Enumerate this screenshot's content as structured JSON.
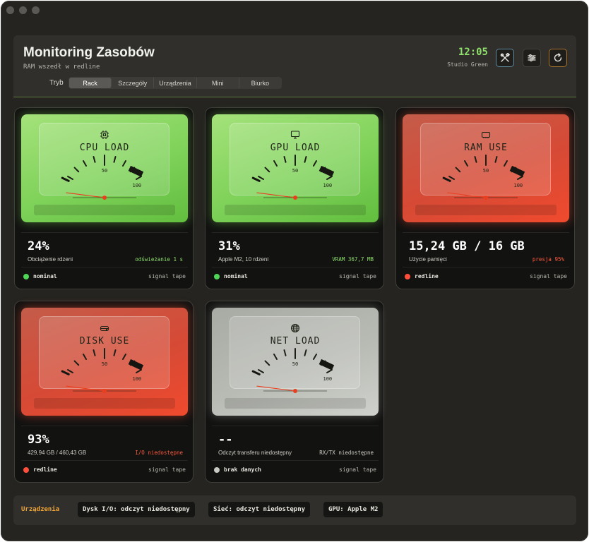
{
  "header": {
    "title": "Monitoring Zasobów",
    "subtitle": "RAM wszedł w redline",
    "mode_label": "Tryb",
    "modes": [
      "Rack",
      "Szczegóły",
      "Urządzenia",
      "Mini",
      "Biurko"
    ],
    "active_mode": "Rack",
    "clock": "12:05",
    "theme": "Studio Green",
    "icons": [
      "tools-icon",
      "sliders-icon",
      "refresh-icon"
    ]
  },
  "cards": [
    {
      "meter_title": "CPU LOAD",
      "icon": "chip-icon",
      "theme": "green",
      "scale_mid": "50",
      "scale_max": "100",
      "value": "24%",
      "description": "Obciążenie rdzeni",
      "note": "odświeżanie 1 s",
      "status": "nominal",
      "tape": "signal tape",
      "level_pct": 24
    },
    {
      "meter_title": "GPU LOAD",
      "icon": "monitor-icon",
      "theme": "green",
      "scale_mid": "50",
      "scale_max": "100",
      "value": "31%",
      "description": "Apple M2, 10 rdzeni",
      "note": "VRAM 367,7 MB",
      "status": "nominal",
      "tape": "signal tape",
      "level_pct": 31
    },
    {
      "meter_title": "RAM USE",
      "icon": "memory-icon",
      "theme": "red",
      "scale_mid": "50",
      "scale_max": "100",
      "value": "15,24 GB / 16 GB",
      "description": "Użycie pamięci",
      "note": "presja 95%",
      "status": "redline",
      "tape": "signal tape",
      "level_pct": 95
    },
    {
      "meter_title": "DISK USE",
      "icon": "disk-icon",
      "theme": "red",
      "scale_mid": "50",
      "scale_max": "100",
      "value": "93%",
      "description": "429,94 GB / 460,43 GB",
      "note": "I/O niedostępne",
      "status": "redline",
      "tape": "signal tape",
      "level_pct": 93
    },
    {
      "meter_title": "NET LOAD",
      "icon": "globe-icon",
      "theme": "gray",
      "scale_mid": "50",
      "scale_max": "100",
      "value": "--",
      "description": "Odczyt transferu niedostępny",
      "note": "RX/TX niedostępne",
      "status": "brak danych",
      "tape": "signal tape",
      "level_pct": 0
    }
  ],
  "footer": {
    "label": "Urządzenia",
    "chips": [
      "Dysk I/O: odczyt niedostępny",
      "Sieć: odczyt niedostępny",
      "GPU: Apple M2"
    ]
  }
}
